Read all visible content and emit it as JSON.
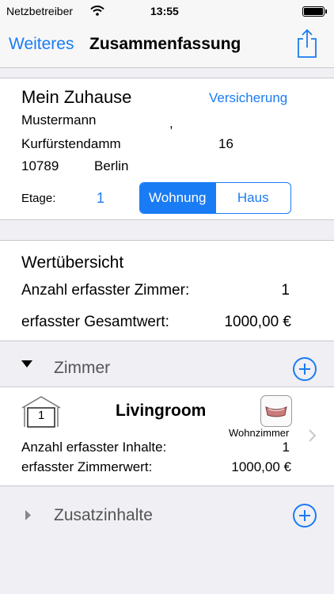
{
  "status": {
    "carrier": "Netzbetreiber",
    "time": "13:55"
  },
  "nav": {
    "back": "Weiteres",
    "title": "Zusammenfassung",
    "share_icon": "share-icon"
  },
  "home": {
    "title": "Mein Zuhause",
    "insurance_link": "Versicherung",
    "name": "Mustermann",
    "comma": ",",
    "street": "Kurfürstendamm",
    "number": "16",
    "zip": "10789",
    "city": "Berlin",
    "floor_label": "Etage:",
    "floor_value": "1",
    "segment": {
      "left": "Wohnung",
      "right": "Haus",
      "selected": "Wohnung"
    }
  },
  "overview": {
    "title": "Wertübersicht",
    "rooms_label": "Anzahl erfasster Zimmer:",
    "rooms_value": "1",
    "total_label": "erfasster Gesamtwert:",
    "total_value": "1000,00 €"
  },
  "rooms_section": {
    "title": "Zimmer"
  },
  "room": {
    "icon_number": "1",
    "name": "Livingroom",
    "type": "Wohnzimmer",
    "contents_label": "Anzahl erfasster Inhalte:",
    "contents_value": "1",
    "value_label": "erfasster Zimmerwert:",
    "value_value": "1000,00 €"
  },
  "extras_section": {
    "title": "Zusatzinhalte"
  },
  "colors": {
    "accent": "#1a7cf4",
    "background": "#efeff4"
  }
}
